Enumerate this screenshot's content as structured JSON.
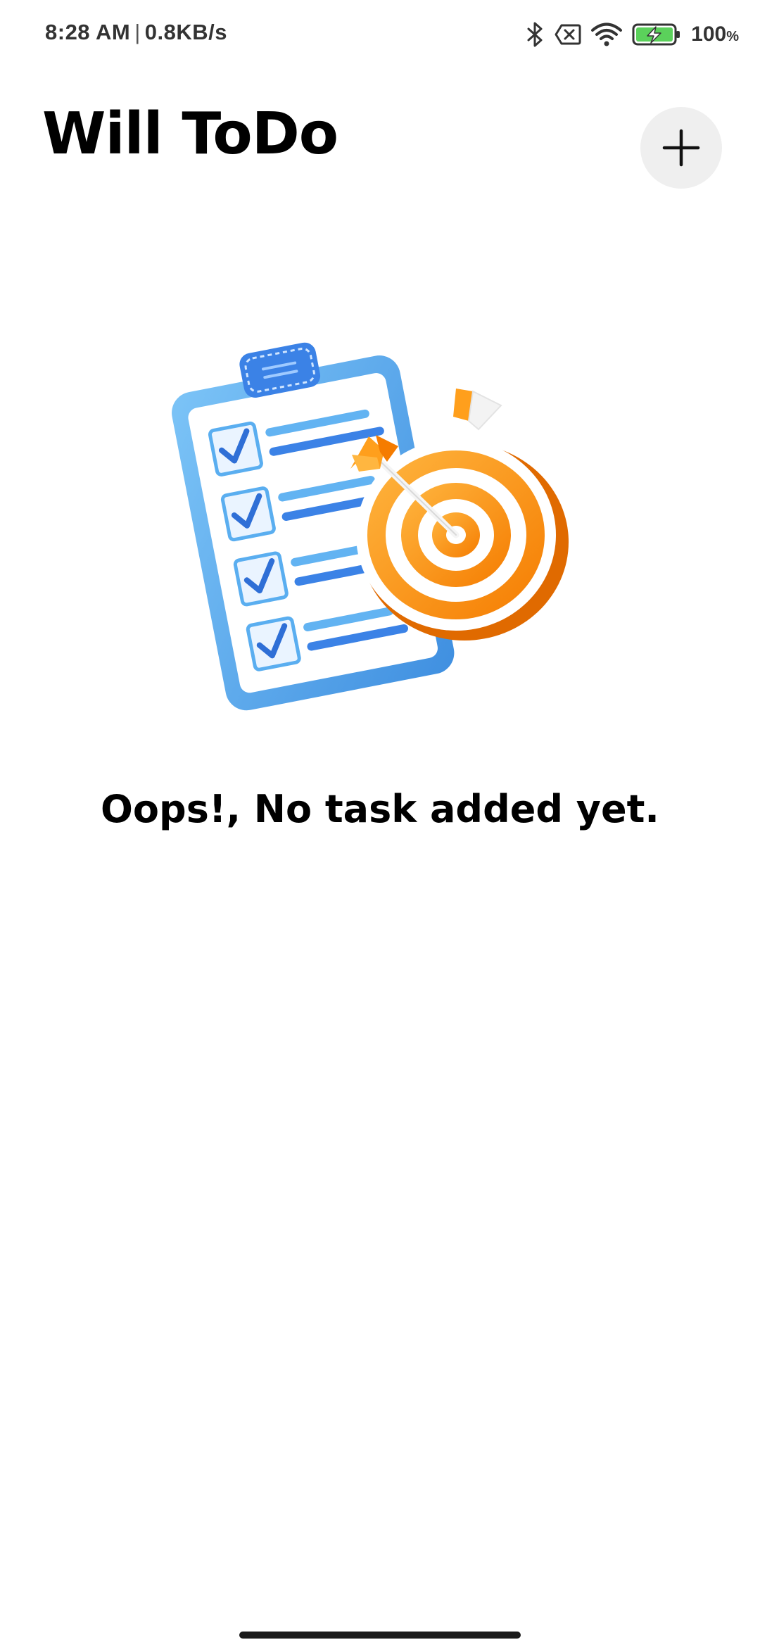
{
  "status_bar": {
    "time": "8:28 AM",
    "separator": "|",
    "network_speed": "0.8KB/s",
    "battery_level": "100",
    "battery_unit": "%",
    "icons": [
      "bluetooth-icon",
      "no-sim-icon",
      "wifi-icon",
      "battery-charging-icon"
    ]
  },
  "header": {
    "title": "Will ToDo",
    "add_button_icon": "plus-icon"
  },
  "empty_state": {
    "illustration": "clipboard-checklist-with-target-illustration",
    "message": "Oops!, No task added yet."
  },
  "colors": {
    "background": "#ffffff",
    "title_text": "#000000",
    "add_button_bg": "#efefef",
    "clipboard_blue": "#5aaef0",
    "target_orange": "#ff9f1c"
  }
}
